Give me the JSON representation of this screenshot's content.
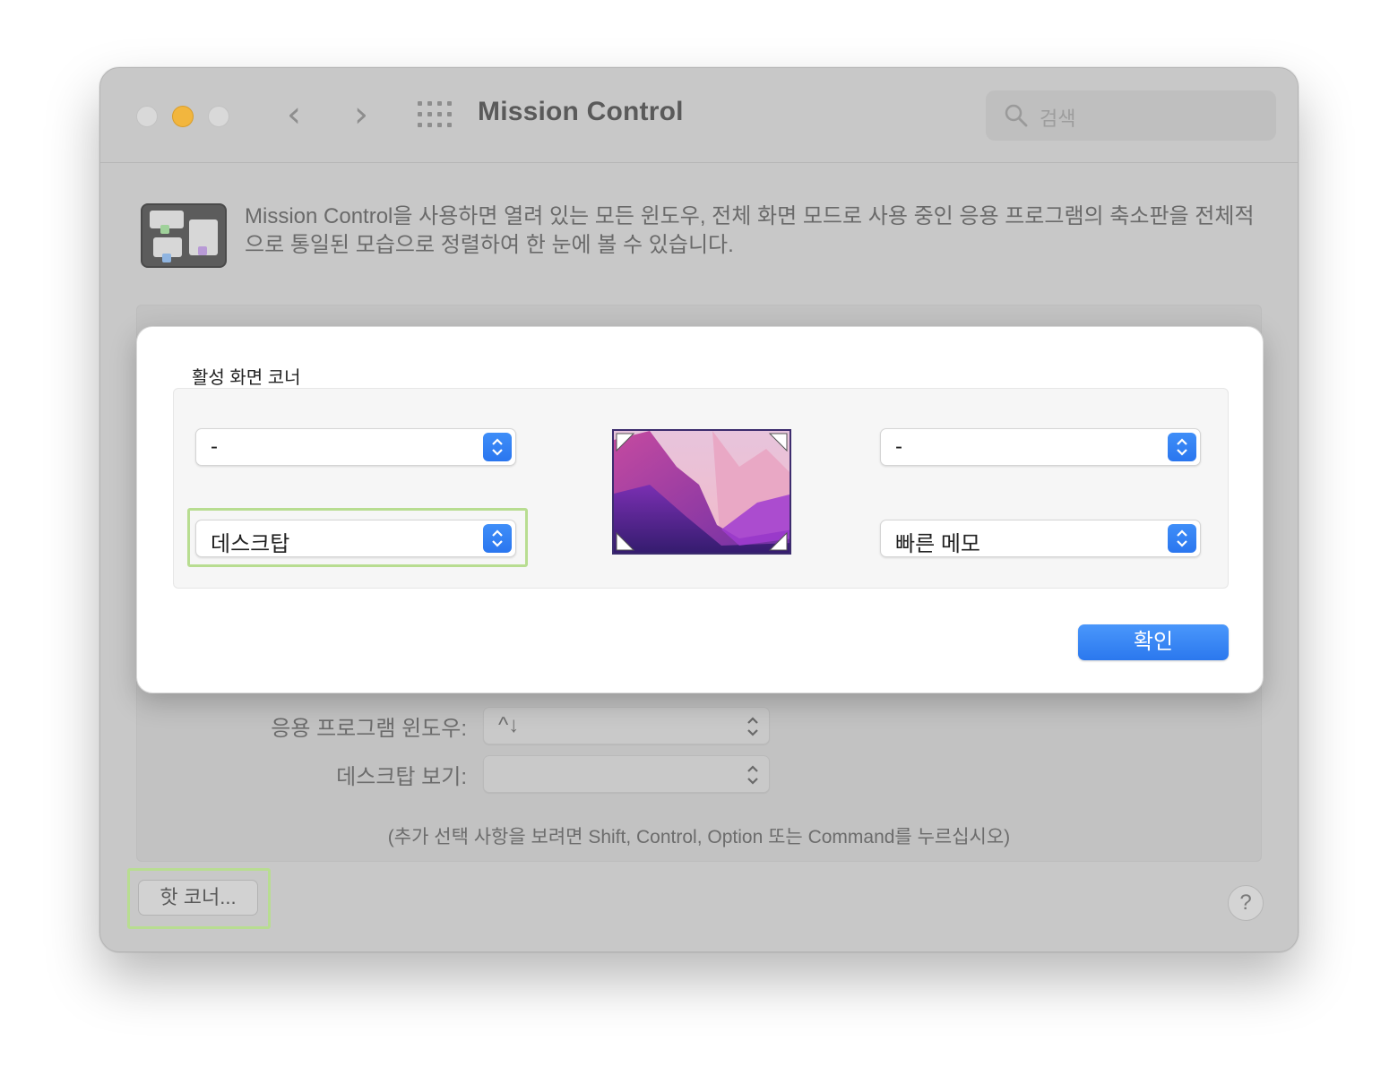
{
  "window": {
    "title": "Mission Control",
    "search": {
      "placeholder": "검색"
    },
    "nav": {
      "back_glyph": "‹",
      "forward_glyph": "›"
    }
  },
  "description": {
    "text": "Mission Control을 사용하면 열려 있는 모든 윈도우, 전체 화면 모드로 사용 중인 응용 프로그램의 축소판을 전체적으로 통일된 모습으로 정렬하여 한 눈에 볼 수 있습니다."
  },
  "settings": {
    "app_windows": {
      "label": "응용 프로그램 윈도우:",
      "value": "^↓"
    },
    "show_desktop": {
      "label": "데스크탑 보기:",
      "value": ""
    },
    "hint": "(추가 선택 사항을 보려면 Shift, Control, Option 또는 Command를 누르십시오)"
  },
  "buttons": {
    "hot_corners": "핫 코너...",
    "help": "?"
  },
  "sheet": {
    "title": "활성 화면 코너",
    "top_left": "-",
    "top_right": "-",
    "bottom_left": "데스크탑",
    "bottom_right": "빠른 메모",
    "ok": "확인"
  },
  "colors": {
    "accent": "#2b78ee",
    "highlight": "#b8dd91",
    "traffic_minimize": "#f2b63e"
  },
  "icons": [
    "search-icon",
    "grid-icon",
    "mission-control-icon",
    "stepper-icon",
    "corner-arrow-icon"
  ]
}
